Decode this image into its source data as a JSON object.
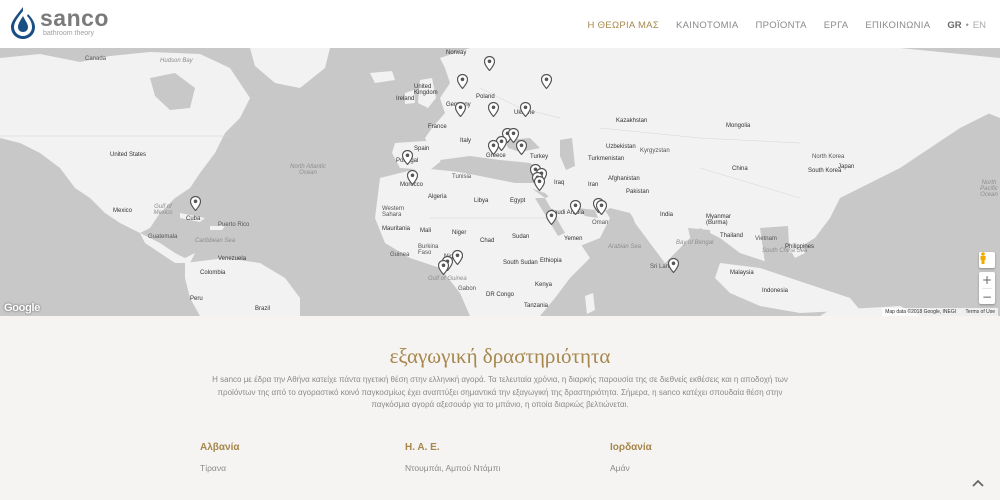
{
  "brand": {
    "name": "sanco",
    "tagline": "bathroom theory",
    "color": "#1a4f86",
    "accent": "#a6874c"
  },
  "nav": {
    "items": [
      {
        "label": "Η ΘΕΩΡΙΑ ΜΑΣ",
        "active": true
      },
      {
        "label": "ΚΑΙΝΟΤΟΜΙΑ",
        "active": false
      },
      {
        "label": "ΠΡΟΪΟΝΤΑ",
        "active": false
      },
      {
        "label": "ΕΡΓΑ",
        "active": false
      },
      {
        "label": "ΕΠΙΚΟΙΝΩΝΙΑ",
        "active": false
      }
    ],
    "lang_gr": "GR",
    "lang_sep": "•",
    "lang_en": "EN"
  },
  "map": {
    "google_logo": "Google",
    "attribution": "Map data ©2018 Google, INEGI",
    "terms": "Terms of Use",
    "zoom_in": "+",
    "zoom_out": "−",
    "labels": {
      "canada": "Canada",
      "united_states": "United States",
      "mexico": "Mexico",
      "venezuela": "Venezuela",
      "colombia": "Colombia",
      "peru": "Peru",
      "brazil": "Brazil",
      "cuba": "Cuba",
      "puerto_rico": "Puerto Rico",
      "guatemala": "Guatemala",
      "north_atlantic": "North Atlantic Ocean",
      "hudson_bay": "Hudson Bay",
      "gulf_mexico": "Gulf of Mexico",
      "caribbean": "Caribbean Sea",
      "norway": "Norway",
      "united_kingdom": "United Kingdom",
      "ireland": "Ireland",
      "germany": "Germany",
      "poland": "Poland",
      "ukraine": "Ukraine",
      "france": "France",
      "spain": "Spain",
      "portugal": "Portugal",
      "italy": "Italy",
      "greece": "Greece",
      "turkey": "Turkey",
      "tunisia": "Tunisia",
      "morocco": "Morocco",
      "algeria": "Algeria",
      "libya": "Libya",
      "egypt": "Egypt",
      "western_sahara": "Western Sahara",
      "mauritania": "Mauritania",
      "mali": "Mali",
      "niger": "Niger",
      "chad": "Chad",
      "sudan": "Sudan",
      "south_sudan": "South Sudan",
      "ethiopia": "Ethiopia",
      "nigeria": "Nigeria",
      "burkina_faso": "Burkina Faso",
      "guinea": "Guinea",
      "gabon": "Gabon",
      "dr_congo": "DR Congo",
      "kenya": "Kenya",
      "tanzania": "Tanzania",
      "gulf_guinea": "Gulf of Guinea",
      "iraq": "Iraq",
      "iran": "Iran",
      "saudi_arabia": "Saudi Arabia",
      "yemen": "Yemen",
      "oman": "Oman",
      "kazakhstan": "Kazakhstan",
      "uzbekistan": "Uzbekistan",
      "turkmenistan": "Turkmenistan",
      "kyrgyzstan": "Kyrgyzstan",
      "afghanistan": "Afghanistan",
      "pakistan": "Pakistan",
      "india": "India",
      "mongolia": "Mongolia",
      "china": "China",
      "north_korea": "North Korea",
      "south_korea": "South Korea",
      "japan": "Japan",
      "myanmar": "Myanmar (Burma)",
      "thailand": "Thailand",
      "vietnam": "Vietnam",
      "philippines": "Philippines",
      "malaysia": "Malaysia",
      "indonesia": "Indonesia",
      "arabian_sea": "Arabian Sea",
      "bay_bengal": "Bay of Bengal",
      "sri_lanka": "Sri Lanka",
      "south_china_sea": "South China Sea",
      "north_pacific": "North Pacific Ocean"
    }
  },
  "section": {
    "title": "εξαγωγική δραστηριότητα",
    "body": "Η sanco με έδρα την Αθήνα κατείχε πάντα ηγετική θέση στην ελληνική αγορά. Τα τελευταία χρόνια, η διαρκής παρουσία της σε διεθνείς εκθέσεις και η αποδοχή των προϊόντων της από το αγοραστικό κοινό παγκοσμίως έχει αναπτύξει σημαντικά την εξαγωγική της δραστηριότητα. Σήμερα, η sanco κατέχει σπουδαία θέση στην παγκόσμια αγορά αξεσουάρ για το μπάνιο, η οποία διαρκώς βελτιώνεται."
  },
  "countries": [
    {
      "name": "Αλβανία",
      "city": "Τίρανα"
    },
    {
      "name": "Η. Α. Ε.",
      "city": "Ντουμπάι, Αμπού Ντάμπι"
    },
    {
      "name": "Ιορδανία",
      "city": "Αμάν"
    }
  ]
}
